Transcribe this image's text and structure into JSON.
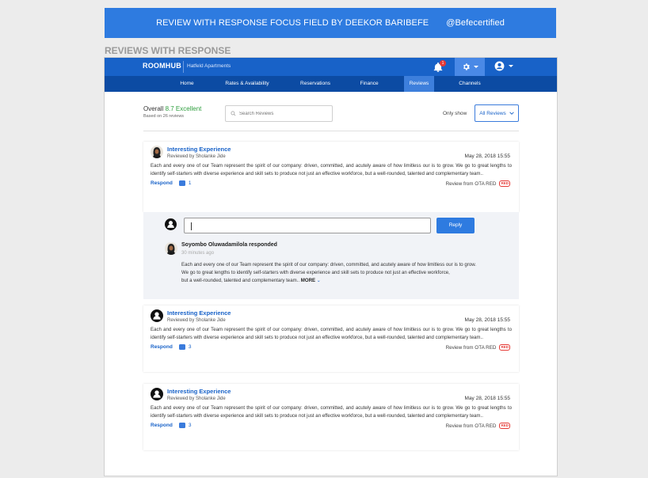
{
  "banner": {
    "title": "REVIEW WITH RESPONSE FOCUS FIELD BY DEEKOR BARIBEFE",
    "handle": "@Befecertified"
  },
  "section_label": "REVIEWS WITH RESPONSE",
  "app": {
    "brand": "ROOMHUB",
    "property": "Hatfeld Apartments",
    "notification_count": "1"
  },
  "nav": {
    "items": [
      "Home",
      "Rates & Availability",
      "Reservations",
      "Finance",
      "Reviews",
      "Channels"
    ],
    "active": "Reviews"
  },
  "summary": {
    "overall_label": "Overall",
    "score": "8.7 Excellent",
    "based_on": "Based on 26 reviews"
  },
  "search": {
    "placeholder": "Search Reviews"
  },
  "filter": {
    "label": "Only show",
    "selected": "All Reviews"
  },
  "colors": {
    "brand_blue": "#1862c8",
    "nav_blue": "#0c4ba3",
    "active_tab": "#3d7fdc",
    "score_green": "#2e9e3e",
    "ota_red": "#e53935"
  },
  "reviews": [
    {
      "title": "Interesting Experience",
      "reviewer": "Reviewed by Sholanke Jide",
      "date": "May 28, 2018 15:55",
      "text": "Each and every one of our Team represent the spirit of our company: driven, committed, and acutely aware of how limitless our  is to grow. We go to great lengths to identify self-starters with diverse experience and skill sets to produce not just an effective workforce, but a well-rounded, talented and complementary team..",
      "respond_label": "Respond",
      "response_count": "1",
      "source": "Review from OTA RED",
      "source_logo": "RED"
    },
    {
      "title": "Interesting Experience",
      "reviewer": "Reviewed by Sholanke Jide",
      "date": "May 28, 2018 15:55",
      "text": "Each and every one of our Team represent the spirit of our company: driven, committed, and acutely aware of how limitless our  is to grow. We go to great lengths to identify self-starters with diverse experience and skill sets to produce not just an effective workforce, but a well-rounded, talented and complementary team..",
      "respond_label": "Respond",
      "response_count": "3",
      "source": "Review from OTA RED",
      "source_logo": "RED"
    },
    {
      "title": "Interesting Experience",
      "reviewer": "Reviewed by Sholanke Jide",
      "date": "May 28, 2018 15:55",
      "text": "Each and every one of our Team represent the spirit of our company: driven, committed, and acutely aware of how limitless our  is to grow. We go to great lengths to identify self-starters with diverse experience and skill sets to produce not just an effective workforce, but a well-rounded, talented and complementary team..",
      "respond_label": "Respond",
      "response_count": "3",
      "source": "Review from OTA RED",
      "source_logo": "RED"
    }
  ],
  "reply": {
    "input_value": "",
    "button_label": "Reply",
    "responder": "Soyombo Oluwadamilola responded",
    "time": "30 minutes ago",
    "text_main": "Each and every one of our Team represent the spirit of our company: driven, committed, and acutely aware of how limitless our  is to grow. We go to great lengths to identify self-starters with diverse experience and skill sets to produce not just an effective workforce,",
    "text_tail": "but a well-rounded, talented and complementary team..",
    "more_label": "MORE"
  }
}
